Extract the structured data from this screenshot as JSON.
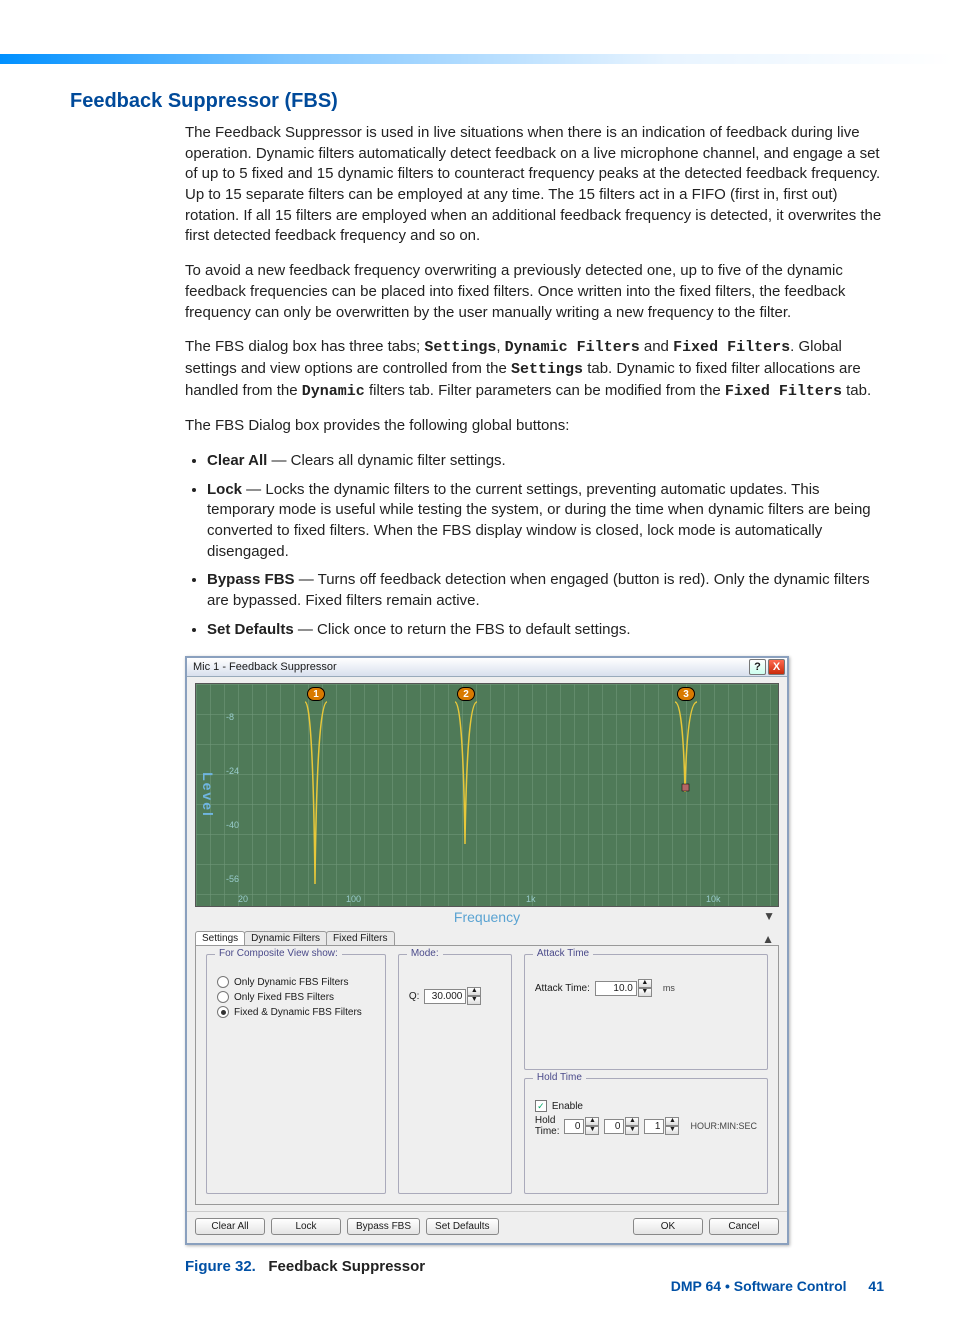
{
  "heading": "Feedback Suppressor (FBS)",
  "para1": "The Feedback Suppressor is used in live situations when there is an indication of feedback during live operation. Dynamic filters automatically detect feedback on a live microphone channel, and engage a set of up to 5 fixed and 15 dynamic filters to counteract frequency peaks at the detected feedback frequency. Up to 15 separate filters can be employed at any time. The 15 filters act in a FIFO (first in, first out) rotation. If all 15 filters are employed when an additional feedback frequency is detected, it overwrites the first detected feedback frequency and so on.",
  "para2": "To avoid a new feedback frequency overwriting a previously detected one, up to five of the dynamic feedback frequencies can be placed into fixed filters. Once written into the fixed filters, the feedback frequency can only be overwritten by the user manually writing a new frequency to the filter.",
  "para3_pre": "The FBS dialog box has three tabs;",
  "para3_tabs": {
    "s": "Settings",
    "d": "Dynamic Filters",
    "f": "Fixed Filters"
  },
  "para3_and": "and",
  "para3_mid1": ". Global settings and view options are controlled from the",
  "para3_mid2": "tab. Dynamic to fixed filter allocations are handled from the",
  "para3_dynword": "Dynamic",
  "para3_mid3": "filters tab. Filter parameters can be modified from the",
  "para3_fixedfilters": "Fixed Filters",
  "para3_end": "tab.",
  "para4": "The FBS Dialog box provides the following global buttons:",
  "bullets": {
    "b1_lead": "Clear All",
    "b1_rest": " — Clears all dynamic filter settings.",
    "b2_lead": "Lock",
    "b2_rest": " — Locks the dynamic filters to the current settings, preventing automatic updates. This temporary mode is useful while testing the system, or during the time when dynamic filters are being converted to fixed filters. When the FBS display window is closed, lock mode is automatically disengaged.",
    "b3_lead": "Bypass FBS",
    "b3_rest": " — Turns off feedback detection when engaged (button is red). Only the dynamic filters are bypassed. Fixed filters remain active.",
    "b4_lead": "Set Defaults",
    "b4_rest": " — Click once to return the FBS to default settings."
  },
  "dialog": {
    "title": "Mic 1 - Feedback Suppressor",
    "help": "?",
    "close": "X",
    "graph": {
      "ylabel": "Level",
      "xlabel": "Frequency",
      "yticks": {
        "a": "-8",
        "b": "-24",
        "c": "-40",
        "d": "-56"
      },
      "xticks": {
        "a": "20",
        "b": "100",
        "c": "1k",
        "d": "10k"
      },
      "callouts": {
        "c1": "1",
        "c2": "2",
        "c3": "3"
      }
    },
    "tabs": {
      "t1": "Settings",
      "t2": "Dynamic Filters",
      "t3": "Fixed Filters"
    },
    "composite": {
      "title": "For Composite View show:",
      "r1": "Only Dynamic FBS Filters",
      "r2": "Only Fixed FBS Filters",
      "r3": "Fixed & Dynamic FBS Filters"
    },
    "mode": {
      "title": "Mode:",
      "q_label": "Q:",
      "q_value": "30.000"
    },
    "attack": {
      "title": "Attack Time",
      "label": "Attack Time:",
      "value": "10.0",
      "unit": "ms"
    },
    "hold": {
      "title": "Hold Time",
      "enable": "Enable",
      "label": "Hold Time:",
      "h": "0",
      "m": "0",
      "s": "1",
      "unit": "HOUR:MIN:SEC"
    },
    "buttons": {
      "clear": "Clear All",
      "lock": "Lock",
      "bypass": "Bypass FBS",
      "defaults": "Set Defaults",
      "ok": "OK",
      "cancel": "Cancel"
    }
  },
  "caption_fig": "Figure 32.",
  "caption_txt": "Feedback Suppressor",
  "footer_prod": "DMP 64 • Software Control",
  "footer_page": "41",
  "chart_data": {
    "type": "line",
    "title": "Feedback Suppressor response (Level vs Frequency)",
    "xlabel": "Frequency",
    "ylabel": "Level",
    "x_scale": "log",
    "xlim": [
      20,
      20000
    ],
    "ylim": [
      -60,
      0
    ],
    "yticks": [
      -8,
      -24,
      -40,
      -56
    ],
    "xticks": [
      20,
      100,
      1000,
      10000
    ],
    "series": [
      {
        "name": "Notch 1",
        "approx_center_hz": 95,
        "approx_depth_db": -58
      },
      {
        "name": "Notch 2",
        "approx_center_hz": 800,
        "approx_depth_db": -46
      },
      {
        "name": "Notch 3",
        "approx_center_hz": 8500,
        "approx_depth_db": -30
      }
    ],
    "callout_markers": [
      1,
      2,
      3
    ]
  }
}
